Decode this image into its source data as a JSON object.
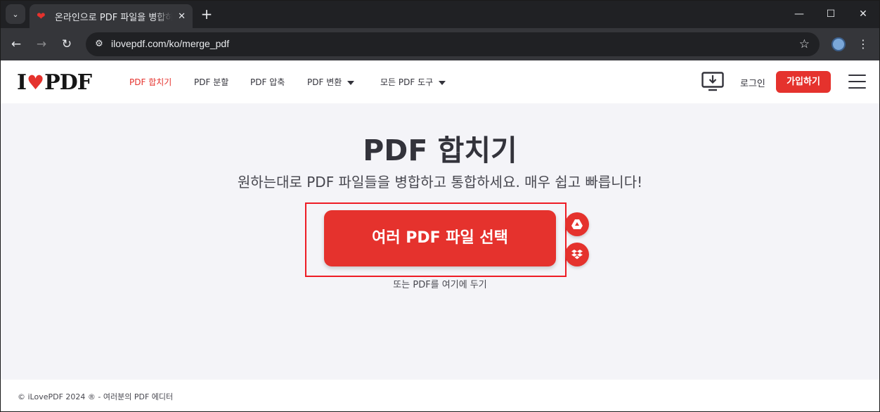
{
  "browser": {
    "tab_title": "온라인으로 PDF 파일을 병합하",
    "url": "ilovepdf.com/ko/merge_pdf"
  },
  "site": {
    "logo_left": "I",
    "logo_right": "PDF",
    "nav": [
      {
        "label": "PDF 합치기",
        "active": true
      },
      {
        "label": "PDF 분할"
      },
      {
        "label": "PDF 압축"
      },
      {
        "label": "PDF 변환"
      },
      {
        "label": "모든 PDF 도구"
      }
    ],
    "login": "로그인",
    "signup": "가입하기",
    "accent": "#e5322d"
  },
  "main": {
    "title": "PDF 합치기",
    "subtitle": "원하는대로 PDF 파일들을 병합하고 통합하세요. 매우 쉽고 빠릅니다!",
    "select_button": "여러 PDF 파일 선택",
    "drop_hint": "또는 PDF를 여기에 두기"
  },
  "footer": {
    "text": "© iLovePDF 2024 ® - 여러분의 PDF 에디터"
  }
}
